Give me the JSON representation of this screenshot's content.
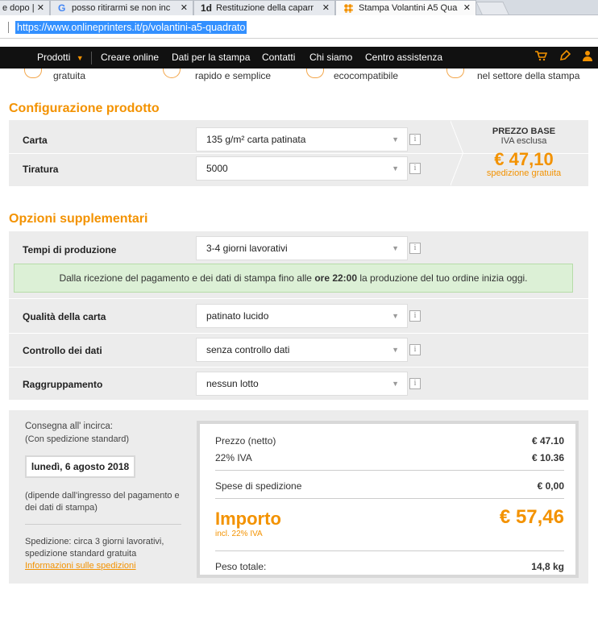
{
  "browser": {
    "tabs": [
      {
        "label": "e dopo |"
      },
      {
        "label": "posso ritirarmi se non inc"
      },
      {
        "label": "Restituzione della caparr"
      },
      {
        "label": "Stampa Volantini A5 Qua"
      }
    ],
    "close_glyph": "✕",
    "url": "https://www.onlineprinters.it/p/volantini-a5-quadrato"
  },
  "nav": {
    "items": [
      "Prodotti",
      "Creare online",
      "Dati per la stampa",
      "Contatti",
      "Chi siamo",
      "Centro assistenza"
    ],
    "accent": "#f39200"
  },
  "benefits": [
    "gratuita",
    "rapido e semplice",
    "ecocompatibile",
    "nel settore della stampa"
  ],
  "config": {
    "title": "Configurazione prodotto",
    "rows": [
      {
        "label": "Carta",
        "value": "135 g/m² carta patinata"
      },
      {
        "label": "Tiratura",
        "value": "5000"
      }
    ],
    "price_label": "PREZZO BASE",
    "price_sub": "IVA esclusa",
    "price": "€ 47,10",
    "price_note": "spedizione gratuita"
  },
  "options": {
    "title": "Opzioni supplementari",
    "rows": [
      {
        "label": "Tempi di produzione",
        "value": "3-4 giorni lavorativi"
      },
      {
        "label": "Qualità della carta",
        "value": "patinato lucido"
      },
      {
        "label": "Controllo dei dati",
        "value": "senza controllo dati"
      },
      {
        "label": "Raggruppamento",
        "value": "nessun lotto"
      }
    ],
    "note_before": "Dalla ricezione del pagamento e dei dati di stampa fino alle",
    "note_bold": "ore 22:00",
    "note_after": "la produzione del tuo ordine inizia oggi."
  },
  "delivery": {
    "title": "Consegna all' incirca:",
    "subtitle": "(Con spedizione standard)",
    "date": "lunedì, 6 agosto 2018",
    "depends": "(dipende dall'ingresso del pagamento e dei dati di stampa)",
    "shipping": "Spedizione: circa 3 giorni lavorativi, spedizione standard gratuita",
    "link": "Informazioni sulle spedizioni"
  },
  "summary": {
    "net_label": "Prezzo (netto)",
    "net_value": "€ 47.10",
    "vat_label": "22% IVA",
    "vat_value": "€ 10.36",
    "ship_label": "Spese di spedizione",
    "ship_value": "€ 0,00",
    "total_label": "Importo",
    "total_sub": "incl. 22% IVA",
    "total_value": "€ 57,46",
    "weight_label": "Peso totale:",
    "weight_value": "14,8 kg"
  }
}
